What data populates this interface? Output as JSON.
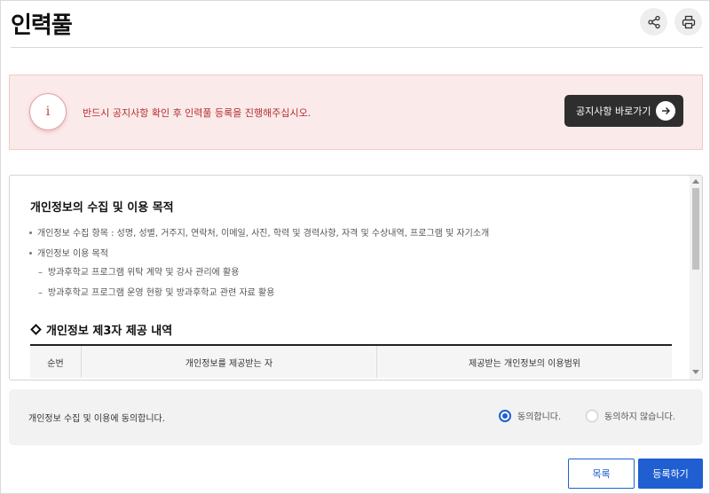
{
  "header": {
    "title": "인력풀",
    "share_icon": "share-icon",
    "print_icon": "printer-icon"
  },
  "notice": {
    "icon_glyph": "i",
    "icon": "info-icon",
    "message": "반드시 공지사항 확인 후 인력풀 등록을 진행해주십시오.",
    "button_label": "공지사항 바로가기",
    "button_icon": "arrow-right-icon"
  },
  "privacy": {
    "title": "개인정보의 수집 및 이용 목적",
    "bullets": [
      "개인정보 수집 항목 : 성명, 성별, 거주지, 연락처, 이메일, 사진, 학력 및 경력사항, 자격 및 수상내역, 프로그램 및 자기소개",
      "개인정보 이용 목적"
    ],
    "sub_items": [
      "방과후학교 프로그램 위탁 계약 및 강사 관리에 활용",
      "방과후학교 프로그램 운영 현황 및 방과후학교 관련 자료 활용"
    ],
    "dash": "–",
    "third_party_title": "개인정보 제3자 제공 내역",
    "table_headers": [
      "순번",
      "개인정보를 제공받는 자",
      "제공받는 개인정보의 이용범위"
    ]
  },
  "consent": {
    "label": "개인정보 수집 및 이용에 동의합니다.",
    "agree": "동의합니다.",
    "disagree": "동의하지 않습니다.",
    "selected": "agree",
    "accent_color": "#1f5fd1"
  },
  "actions": {
    "list_label": "목록",
    "register_label": "등록하기"
  }
}
